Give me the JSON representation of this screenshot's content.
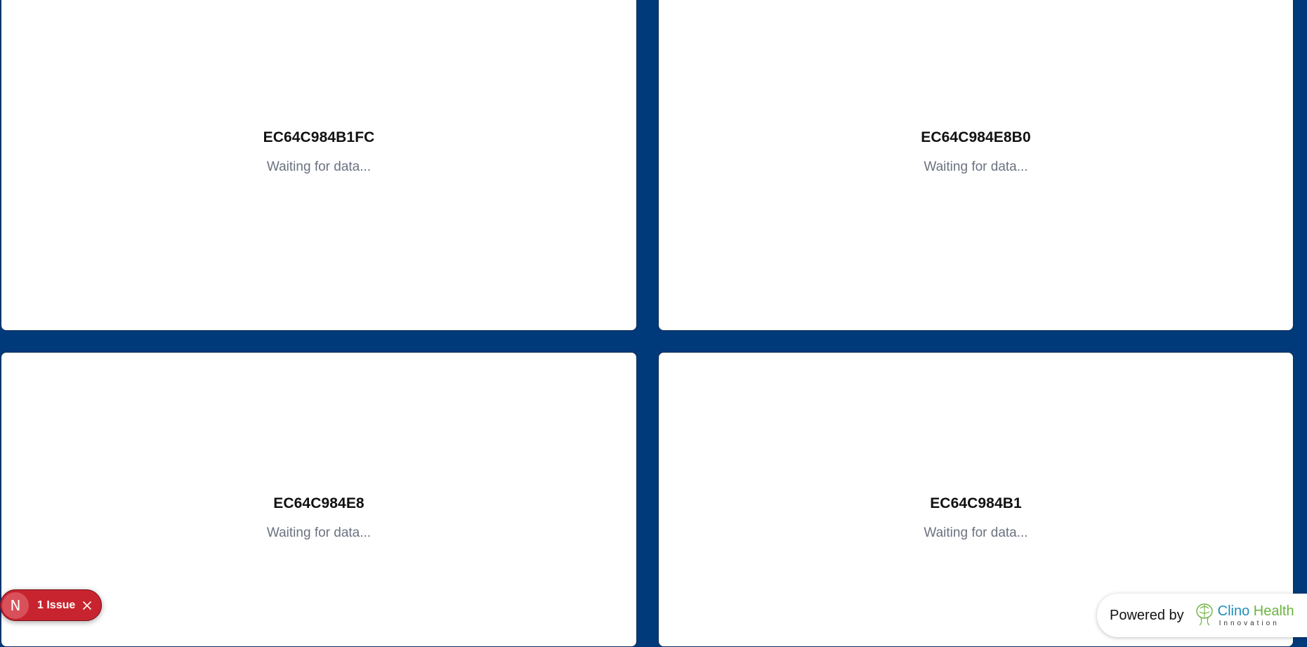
{
  "devices": [
    {
      "id": "EC64C984B1FC",
      "status": "Waiting for data..."
    },
    {
      "id": "EC64C984E8B0",
      "status": "Waiting for data..."
    },
    {
      "id": "EC64C984E8",
      "status": "Waiting for data..."
    },
    {
      "id": "EC64C984B1",
      "status": "Waiting for data..."
    }
  ],
  "issue_badge": {
    "avatar_letter": "N",
    "label": "1 Issue",
    "close_icon": "close-icon"
  },
  "footer": {
    "powered_label": "Powered by",
    "logo_name_1": "Clino",
    "logo_name_2": "Health",
    "logo_tagline": "Innovation"
  },
  "colors": {
    "background": "#003a7a",
    "card": "#ffffff",
    "status_text": "#6b7280",
    "issue_badge": "#c8242f",
    "logo_blue": "#1d8fb8",
    "logo_green": "#6cb33f"
  }
}
